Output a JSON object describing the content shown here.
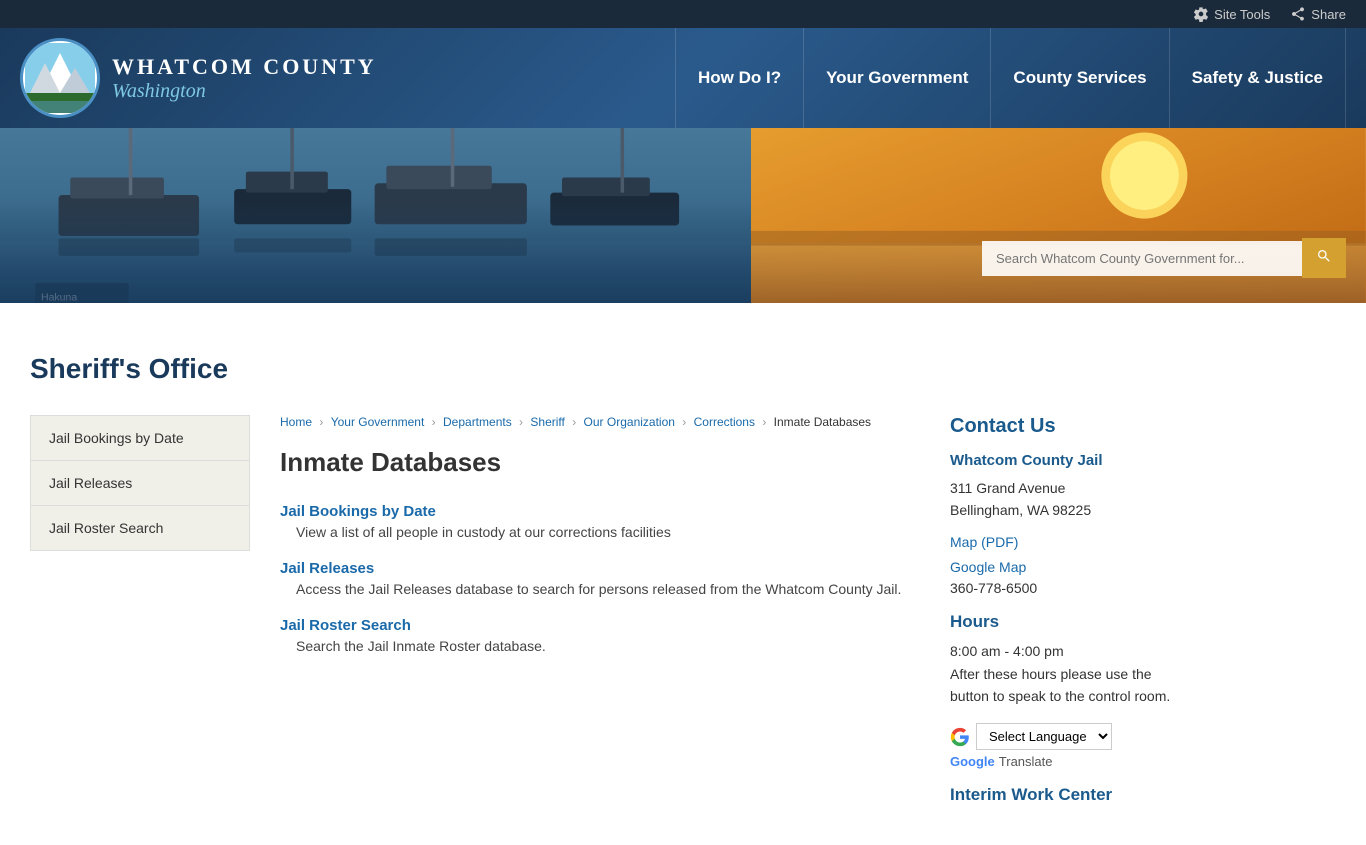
{
  "topbar": {
    "site_tools": "Site Tools",
    "share": "Share"
  },
  "header": {
    "county_name": "WHATCOM COUNTY",
    "state_name": "Washington",
    "nav": [
      {
        "label": "How Do I?"
      },
      {
        "label": "Your Government"
      },
      {
        "label": "County Services"
      },
      {
        "label": "Safety & Justice"
      }
    ]
  },
  "hero": {
    "search_placeholder": "Search Whatcom County Government for...",
    "boats_label": "Hakuna Matata"
  },
  "page": {
    "title": "Sheriff's Office"
  },
  "sidebar": {
    "items": [
      {
        "label": "Jail Bookings by Date"
      },
      {
        "label": "Jail Releases"
      },
      {
        "label": "Jail Roster Search"
      }
    ]
  },
  "breadcrumb": {
    "parts": [
      {
        "label": "Home",
        "href": "#"
      },
      {
        "label": "Your Government",
        "href": "#"
      },
      {
        "label": "Departments",
        "href": "#"
      },
      {
        "label": "Sheriff",
        "href": "#"
      },
      {
        "label": "Our Organization",
        "href": "#"
      },
      {
        "label": "Corrections",
        "href": "#"
      }
    ],
    "current": "Inmate Databases"
  },
  "article": {
    "title": "Inmate Databases",
    "sections": [
      {
        "link_label": "Jail Bookings by Date",
        "description": "View a list of all people in custody at our corrections facilities"
      },
      {
        "link_label": "Jail Releases",
        "description": "Access the Jail Releases database to search for persons released from the Whatcom County Jail."
      },
      {
        "link_label": "Jail Roster Search",
        "description": "Search the Jail Inmate Roster database."
      }
    ]
  },
  "contact": {
    "section_title": "Contact Us",
    "org_name": "Whatcom County Jail",
    "address_line1": "311 Grand Avenue",
    "address_line2": "Bellingham, WA 98225",
    "map_pdf": "Map (PDF)",
    "google_map": "Google Map",
    "phone": "360-778-6500",
    "hours_title": "Hours",
    "hours_line1": "8:00 am - 4:00 pm",
    "hours_note": "After these hours please use the button to speak to the control room.",
    "interim_title": "Interim Work Center"
  },
  "language": {
    "select_label": "Select Language",
    "google_label": "Google",
    "translate_label": "Translate"
  }
}
